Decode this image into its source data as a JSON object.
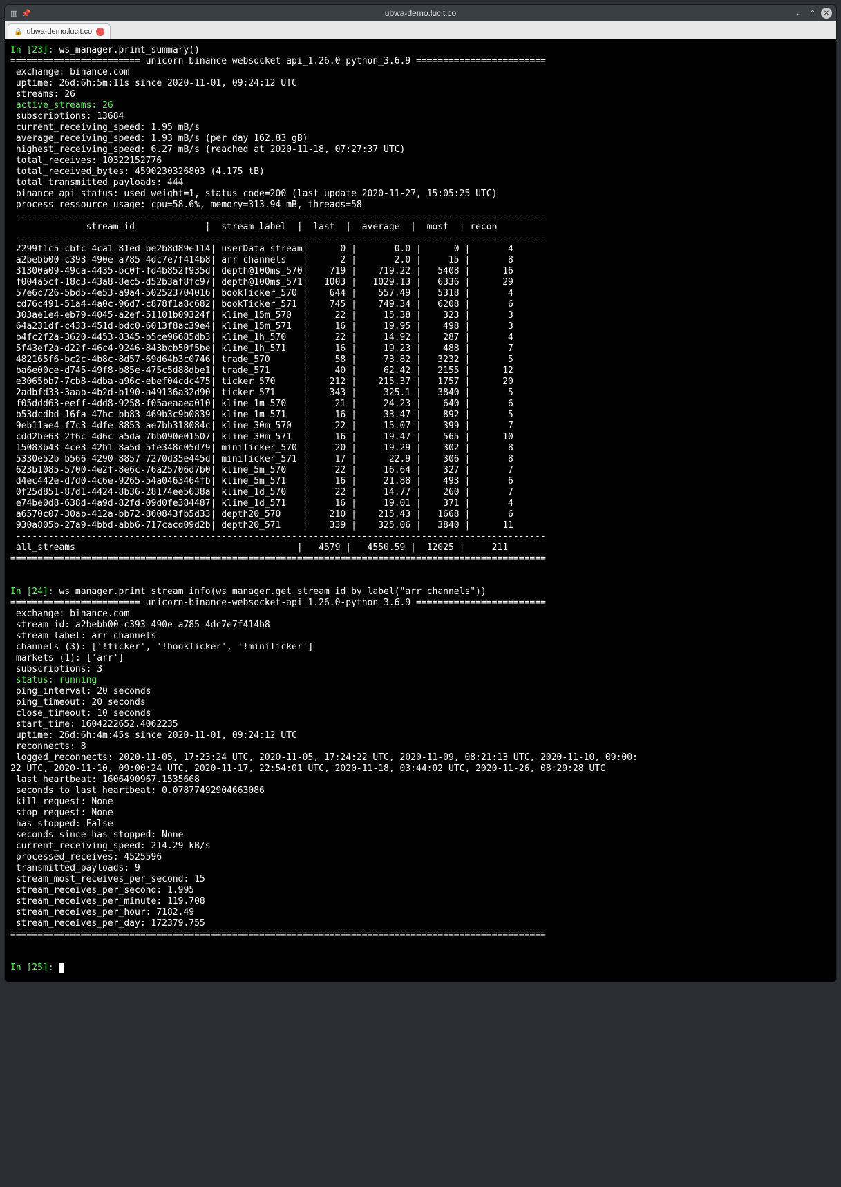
{
  "window": {
    "title": "ubwa-demo.lucit.co"
  },
  "tab": {
    "label": "ubwa-demo.lucit.co"
  },
  "prompts": {
    "in23": "In [23]: ",
    "cmd23": "ws_manager.print_summary()",
    "in24": "In [24]: ",
    "cmd24": "ws_manager.print_stream_info(ws_manager.get_stream_id_by_label(\"arr channels\"))",
    "in25": "In [25]: "
  },
  "banner": "======================== unicorn-binance-websocket-api_1.26.0-python_3.6.9 ========================",
  "summary": {
    "exchange": " exchange: binance.com",
    "uptime": " uptime: 26d:6h:5m:11s since 2020-11-01, 09:24:12 UTC",
    "streams": " streams: 26",
    "active_streams": " active_streams: 26",
    "subscriptions": " subscriptions: 13684",
    "crs": " current_receiving_speed: 1.95 mB/s",
    "ars": " average_receiving_speed: 1.93 mB/s (per day 162.83 gB)",
    "hrs": " highest_receiving_speed: 6.27 mB/s (reached at 2020-11-18, 07:27:37 UTC)",
    "tr": " total_receives: 10322152776",
    "trb": " total_received_bytes: 4590230326803 (4.175 tB)",
    "ttp": " total_transmitted_payloads: 444",
    "api": " binance_api_status: used_weight=1, status_code=200 (last update 2020-11-27, 15:05:25 UTC)",
    "pru": " process_ressource_usage: cpu=58.6%, memory=313.94 mB, threads=58"
  },
  "dash_line": " --------------------------------------------------------------------------------------------------",
  "table_header": "              stream_id             |  stream_label  |  last  |  average  |  most  | recon",
  "rows": [
    {
      "id": "2299f1c5-cbfc-4ca1-81ed-be2b8d89e114",
      "label": "userData stream",
      "last": "0",
      "avg": "0.0",
      "most": "0",
      "recon": "4"
    },
    {
      "id": "a2bebb00-c393-490e-a785-4dc7e7f414b8",
      "label": "arr channels",
      "last": "2",
      "avg": "2.0",
      "most": "15",
      "recon": "8"
    },
    {
      "id": "31300a09-49ca-4435-bc0f-fd4b852f935d",
      "label": "depth@100ms_570",
      "last": "719",
      "avg": "719.22",
      "most": "5408",
      "recon": "16"
    },
    {
      "id": "f004a5cf-18c3-43a8-8ec5-d52b3af8fc97",
      "label": "depth@100ms_571",
      "last": "1003",
      "avg": "1029.13",
      "most": "6336",
      "recon": "29"
    },
    {
      "id": "57e6c726-5bd5-4e53-a9a4-502523704016",
      "label": "bookTicker_570",
      "last": "644",
      "avg": "557.49",
      "most": "5318",
      "recon": "4"
    },
    {
      "id": "cd76c491-51a4-4a0c-96d7-c878f1a8c682",
      "label": "bookTicker_571",
      "last": "745",
      "avg": "749.34",
      "most": "6208",
      "recon": "6"
    },
    {
      "id": "303ae1e4-eb79-4045-a2ef-51101b09324f",
      "label": "kline_15m_570",
      "last": "22",
      "avg": "15.38",
      "most": "323",
      "recon": "3"
    },
    {
      "id": "64a231df-c433-451d-bdc0-6013f8ac39e4",
      "label": "kline_15m_571",
      "last": "16",
      "avg": "19.95",
      "most": "498",
      "recon": "3"
    },
    {
      "id": "b4fc2f2a-3620-4453-8345-b5ce96685db3",
      "label": "kline_1h_570",
      "last": "22",
      "avg": "14.92",
      "most": "287",
      "recon": "4"
    },
    {
      "id": "5f43ef2a-d22f-46c4-9246-843bcb50f5be",
      "label": "kline_1h_571",
      "last": "16",
      "avg": "19.23",
      "most": "488",
      "recon": "7"
    },
    {
      "id": "482165f6-bc2c-4b8c-8d57-69d64b3c0746",
      "label": "trade_570",
      "last": "58",
      "avg": "73.82",
      "most": "3232",
      "recon": "5"
    },
    {
      "id": "ba6e00ce-d745-49f8-b85e-475c5d88dbe1",
      "label": "trade_571",
      "last": "40",
      "avg": "62.42",
      "most": "2155",
      "recon": "12"
    },
    {
      "id": "e3065bb7-7cb8-4dba-a96c-ebef04cdc475",
      "label": "ticker_570",
      "last": "212",
      "avg": "215.37",
      "most": "1757",
      "recon": "20"
    },
    {
      "id": "2adbfd33-3aab-4b2d-b190-a49136a32d90",
      "label": "ticker_571",
      "last": "343",
      "avg": "325.1",
      "most": "3840",
      "recon": "5"
    },
    {
      "id": "f05ddd63-eeff-4dd8-9258-f05aeaaea010",
      "label": "kline_1m_570",
      "last": "21",
      "avg": "24.23",
      "most": "640",
      "recon": "6"
    },
    {
      "id": "b53dcdbd-16fa-47bc-bb83-469b3c9b0839",
      "label": "kline_1m_571",
      "last": "16",
      "avg": "33.47",
      "most": "892",
      "recon": "5"
    },
    {
      "id": "9eb11ae4-f7c3-4dfe-8853-ae7bb318084c",
      "label": "kline_30m_570",
      "last": "22",
      "avg": "15.07",
      "most": "399",
      "recon": "7"
    },
    {
      "id": "cdd2be63-2f6c-4d6c-a5da-7bb090e01507",
      "label": "kline_30m_571",
      "last": "16",
      "avg": "19.47",
      "most": "565",
      "recon": "10"
    },
    {
      "id": "15083b43-4ce3-42b1-8a5d-5fe348c05d79",
      "label": "miniTicker_570",
      "last": "20",
      "avg": "19.29",
      "most": "302",
      "recon": "8"
    },
    {
      "id": "5330e52b-b566-4290-8857-7270d35e445d",
      "label": "miniTicker_571",
      "last": "17",
      "avg": "22.9",
      "most": "306",
      "recon": "8"
    },
    {
      "id": "623b1085-5700-4e2f-8e6c-76a25706d7b0",
      "label": "kline_5m_570",
      "last": "22",
      "avg": "16.64",
      "most": "327",
      "recon": "7"
    },
    {
      "id": "d4ec442e-d7d0-4c6e-9265-54a0463464fb",
      "label": "kline_5m_571",
      "last": "16",
      "avg": "21.88",
      "most": "493",
      "recon": "6"
    },
    {
      "id": "0f25d851-87d1-4424-8b36-28174ee5638a",
      "label": "kline_1d_570",
      "last": "22",
      "avg": "14.77",
      "most": "260",
      "recon": "7"
    },
    {
      "id": "e74be0d8-638d-4a9d-82fd-09d0fe384487",
      "label": "kline_1d_571",
      "last": "16",
      "avg": "19.01",
      "most": "371",
      "recon": "4"
    },
    {
      "id": "a6570c07-30ab-412a-bb72-860843fb5d33",
      "label": "depth20_570",
      "last": "210",
      "avg": "215.43",
      "most": "1668",
      "recon": "6"
    },
    {
      "id": "930a805b-27a9-4bbd-abb6-717cacd09d2b",
      "label": "depth20_571",
      "last": "339",
      "avg": "325.06",
      "most": "3840",
      "recon": "11"
    }
  ],
  "all_streams_row": " all_streams                                         |   4579 |   4550.59 |  12025 |     211",
  "footer_eq": "===================================================================================================",
  "stream_info": {
    "exchange": " exchange: binance.com",
    "stream_id": " stream_id: a2bebb00-c393-490e-a785-4dc7e7f414b8",
    "stream_label": " stream_label: arr channels",
    "channels": " channels (3): ['!ticker', '!bookTicker', '!miniTicker']",
    "markets": " markets (1): ['arr']",
    "subscriptions": " subscriptions: 3",
    "status": " status: running",
    "ping_interval": " ping_interval: 20 seconds",
    "ping_timeout": " ping_timeout: 20 seconds",
    "close_timeout": " close_timeout: 10 seconds",
    "start_time": " start_time: 1604222652.4062235",
    "uptime": " uptime: 26d:6h:4m:45s since 2020-11-01, 09:24:12 UTC",
    "reconnects": " reconnects: 8",
    "logged_reconnects1": " logged_reconnects: 2020-11-05, 17:23:24 UTC, 2020-11-05, 17:24:22 UTC, 2020-11-09, 08:21:13 UTC, 2020-11-10, 09:00:",
    "logged_reconnects2": "22 UTC, 2020-11-10, 09:00:24 UTC, 2020-11-17, 22:54:01 UTC, 2020-11-18, 03:44:02 UTC, 2020-11-26, 08:29:28 UTC",
    "last_heartbeat": " last_heartbeat: 1606490967.1535668",
    "seconds_to_last_heartbeat": " seconds_to_last_heartbeat: 0.07877492904663086",
    "kill_request": " kill_request: None",
    "stop_request": " stop_request: None",
    "has_stopped": " has_stopped: False",
    "seconds_since_has_stopped": " seconds_since_has_stopped: None",
    "crs": " current_receiving_speed: 214.29 kB/s",
    "processed_receives": " processed_receives: 4525596",
    "transmitted_payloads": " transmitted_payloads: 9",
    "smrps": " stream_most_receives_per_second: 15",
    "srps": " stream_receives_per_second: 1.995",
    "srpm": " stream_receives_per_minute: 119.708",
    "srph": " stream_receives_per_hour: 7182.49",
    "srpd": " stream_receives_per_day: 172379.755"
  }
}
